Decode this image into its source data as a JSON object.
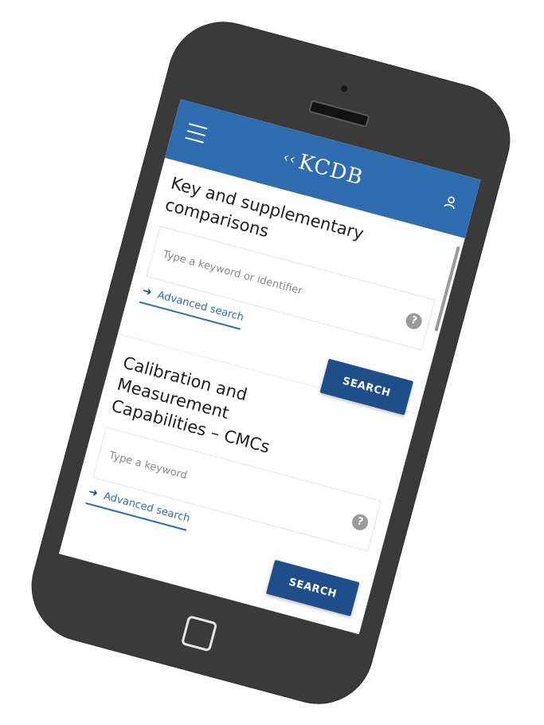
{
  "app": {
    "logo_text": "KCDB",
    "logo_mark": "‹‹"
  },
  "sections": [
    {
      "title_line1": "Key and supplementary",
      "title_line2": "comparisons",
      "placeholder": "Type a keyword or identifier",
      "help": "?",
      "advanced_label": "Advanced search",
      "search_label": "SEARCH"
    },
    {
      "title_line1": "Calibration and",
      "title_line2": "Measurement",
      "title_line3": "Capabilities – CMCs",
      "placeholder": "Type a keyword",
      "help": "?",
      "advanced_label": "Advanced search",
      "search_label": "SEARCH"
    }
  ],
  "icons": {
    "menu": "hamburger-icon",
    "user": "user-icon",
    "help": "help-icon",
    "arrow": "arrow-right-icon"
  },
  "colors": {
    "header": "#2f6cb0",
    "button": "#1f4f8a",
    "phone_body": "#3a3a3a"
  }
}
